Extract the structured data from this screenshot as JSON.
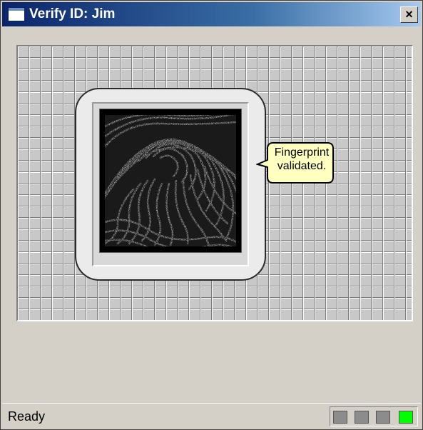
{
  "window": {
    "title": "Verify ID: Jim",
    "close_glyph": "×",
    "icon": "window-app-icon"
  },
  "verification": {
    "message_line1": "Fingerprint",
    "message_line2": "validated."
  },
  "statusbar": {
    "text": "Ready",
    "indicators": [
      {
        "name": "indicator-1",
        "state": "off",
        "color": "#8c8c8c"
      },
      {
        "name": "indicator-2",
        "state": "off",
        "color": "#8c8c8c"
      },
      {
        "name": "indicator-3",
        "state": "off",
        "color": "#8c8c8c"
      },
      {
        "name": "indicator-4",
        "state": "on",
        "color": "#00ff00"
      }
    ]
  },
  "colors": {
    "titlebar_start": "#0a246a",
    "titlebar_end": "#a6caf0",
    "window_face": "#d4d0c8",
    "callout_fill": "#ffffc0",
    "indicator_active": "#00ff00"
  }
}
